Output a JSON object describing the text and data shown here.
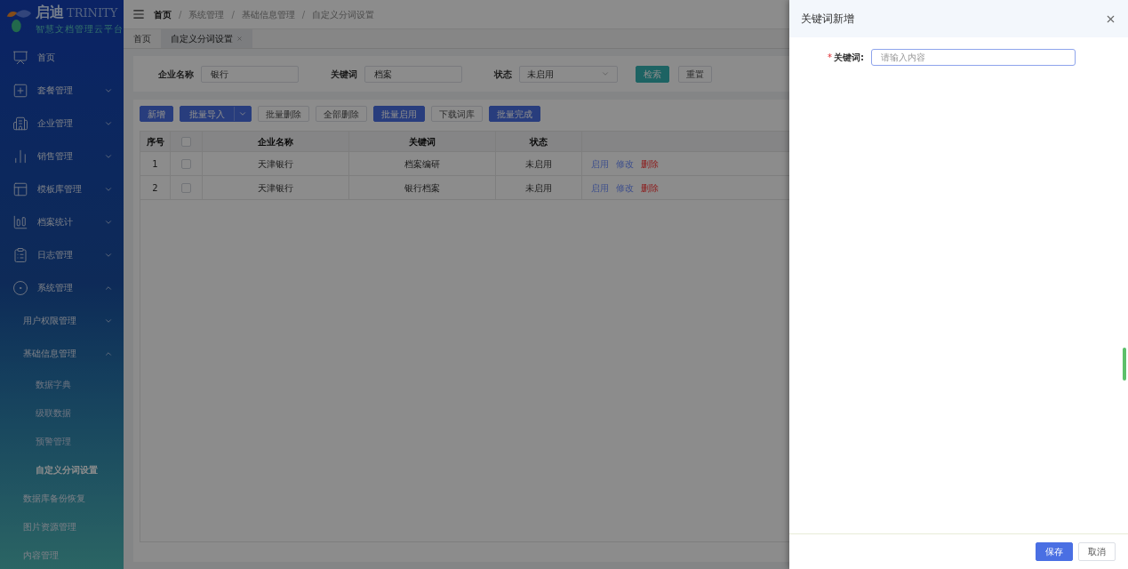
{
  "logo": {
    "name": "启迪",
    "brand": "TRINITY",
    "tagline": "智慧文档管理云平台"
  },
  "sidebar": {
    "items": [
      {
        "label": "首页",
        "kind": "link"
      },
      {
        "label": "套餐管理",
        "kind": "group",
        "expanded": false
      },
      {
        "label": "企业管理",
        "kind": "group",
        "expanded": false
      },
      {
        "label": "销售管理",
        "kind": "group",
        "expanded": false
      },
      {
        "label": "模板库管理",
        "kind": "group",
        "expanded": false
      },
      {
        "label": "档案统计",
        "kind": "group",
        "expanded": false
      },
      {
        "label": "日志管理",
        "kind": "group",
        "expanded": false
      },
      {
        "label": "系统管理",
        "kind": "group",
        "expanded": true,
        "children": [
          {
            "label": "用户权限管理",
            "kind": "group",
            "expanded": false
          },
          {
            "label": "基础信息管理",
            "kind": "group",
            "expanded": true,
            "children": [
              {
                "label": "数据字典",
                "kind": "link",
                "selected": false
              },
              {
                "label": "级联数据",
                "kind": "link",
                "selected": false
              },
              {
                "label": "预警管理",
                "kind": "link",
                "selected": false
              },
              {
                "label": "自定义分词设置",
                "kind": "link",
                "selected": true
              }
            ]
          },
          {
            "label": "数据库备份恢复",
            "kind": "link"
          },
          {
            "label": "图片资源管理",
            "kind": "link"
          },
          {
            "label": "内容管理",
            "kind": "link"
          }
        ]
      }
    ]
  },
  "breadcrumb": {
    "separator": "/",
    "items": [
      "首页",
      "系统管理",
      "基础信息管理",
      "自定义分词设置"
    ]
  },
  "tabs": [
    {
      "label": "首页",
      "selected": false,
      "closable": false
    },
    {
      "label": "自定义分词设置",
      "selected": true,
      "closable": true
    }
  ],
  "filters": [
    {
      "label": "企业名称",
      "value": "银行",
      "kind": "text"
    },
    {
      "label": "关键词",
      "value": "档案",
      "kind": "text"
    },
    {
      "label": "状态",
      "value": "未启用",
      "kind": "select"
    }
  ],
  "filter_buttons": [
    {
      "label": "检索",
      "kind": "search"
    },
    {
      "label": "重置",
      "kind": "plain"
    }
  ],
  "toolbar": [
    {
      "label": "新增",
      "kind": "primary"
    },
    {
      "label": "批量导入",
      "kind": "split"
    },
    {
      "label": "批量删除",
      "kind": "plain"
    },
    {
      "label": "全部删除",
      "kind": "plain"
    },
    {
      "label": "批量启用",
      "kind": "primary"
    },
    {
      "label": "下载词库",
      "kind": "plain"
    },
    {
      "label": "批量完成",
      "kind": "primary"
    }
  ],
  "table": {
    "columns": [
      "序号",
      "企业名称",
      "关键词",
      "状态"
    ],
    "select_all": {
      "checked": false
    },
    "rows": [
      {
        "index": "1",
        "checked": false,
        "company": "天津银行",
        "keyword": "档案编研",
        "status": "未启用",
        "actions": [
          {
            "label": "启用",
            "kind": "link"
          },
          {
            "label": "修改",
            "kind": "link"
          },
          {
            "label": "删除",
            "kind": "danger"
          }
        ]
      },
      {
        "index": "2",
        "checked": false,
        "company": "天津银行",
        "keyword": "银行档案",
        "status": "未启用",
        "actions": [
          {
            "label": "启用",
            "kind": "link"
          },
          {
            "label": "修改",
            "kind": "link"
          },
          {
            "label": "删除",
            "kind": "danger"
          }
        ]
      }
    ]
  },
  "drawer": {
    "title": "关键词新增",
    "fields": [
      {
        "label": "关键词:",
        "required_mark": "*",
        "placeholder": "请输入内容"
      }
    ],
    "buttons": [
      {
        "label": "保存",
        "kind": "primary"
      },
      {
        "label": "取消",
        "kind": "plain"
      }
    ]
  }
}
